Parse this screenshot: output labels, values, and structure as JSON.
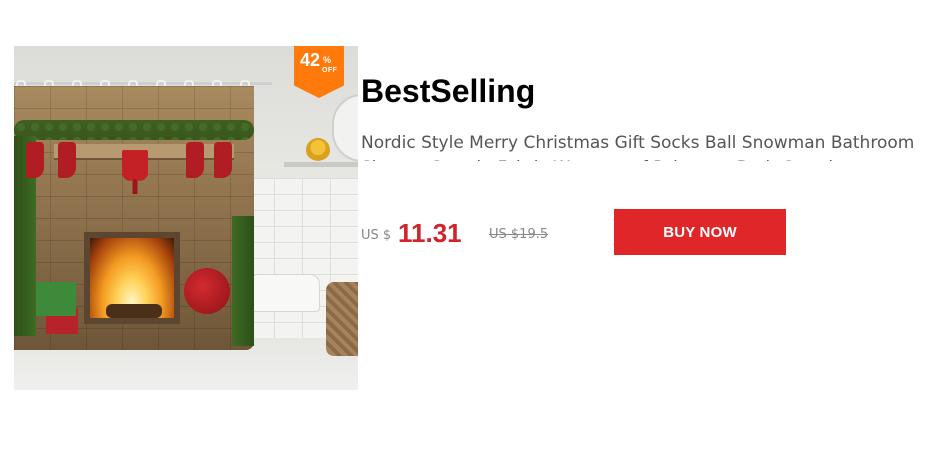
{
  "badge": {
    "discount_number": "42",
    "discount_percent": "%",
    "discount_off": "OFF",
    "color": "#ff7a0a"
  },
  "heading": "BestSelling",
  "product": {
    "title": "Nordic Style Merry Christmas Gift Socks Ball Snowman Bathroom Shower Curtain Fabric Waterproof Polyester Bath Curtain",
    "image_subject": "christmas-fireplace-shower-curtain",
    "currency_label": "US $",
    "price": "11.31",
    "original_price": "US $19.5",
    "price_color": "#d2232a"
  },
  "actions": {
    "buy_label": "BUY NOW",
    "buy_color": "#e1262a"
  }
}
